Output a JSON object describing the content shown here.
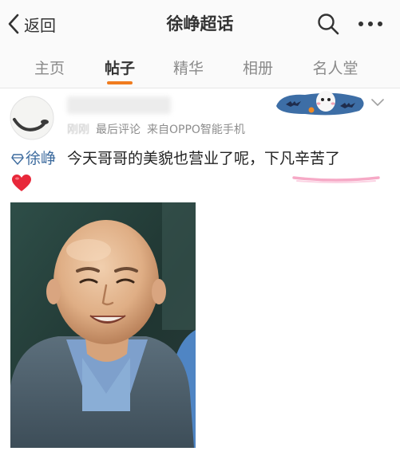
{
  "header": {
    "back_label": "返回",
    "title": "徐峥超话",
    "search_icon": "search-icon",
    "more_icon": "more-icon"
  },
  "tabs": [
    {
      "label": "主页",
      "active": false
    },
    {
      "label": "帖子",
      "active": true
    },
    {
      "label": "精华",
      "active": false
    },
    {
      "label": "相册",
      "active": false
    },
    {
      "label": "名人堂",
      "active": false
    }
  ],
  "post": {
    "time": "刚刚",
    "sort_label": "最后评论",
    "source": "来自OPPO智能手机",
    "topic_link": "徐峥",
    "text": "今天哥哥的美貌也营业了呢，下凡辛苦了",
    "emoji": "heart-icon"
  },
  "colors": {
    "accent_orange": "#f07c1f",
    "link_blue": "#3d6b9e",
    "heart_red": "#e8283a",
    "highlight_pink": "#f6a9c6"
  }
}
